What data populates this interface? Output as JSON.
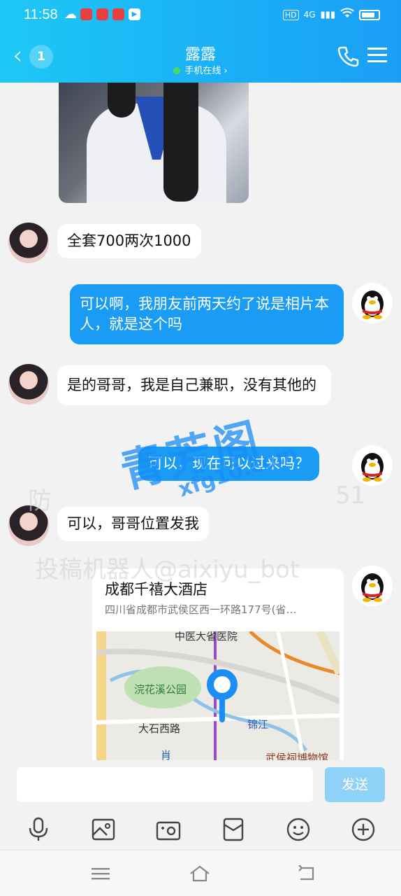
{
  "status_bar": {
    "time": "11:58",
    "network": "4G",
    "hd": "HD"
  },
  "header": {
    "back_count": "1",
    "contact_name": "露露",
    "status": "手机在线 ›"
  },
  "messages": [
    {
      "from": "contact",
      "text": "全套700两次1000"
    },
    {
      "from": "me",
      "text": "可以啊，我朋友前两天约了说是相片本人，就是这个吗"
    },
    {
      "from": "contact",
      "text": "是的哥哥，我是自己兼职，没有其他的"
    },
    {
      "from": "me",
      "text": "可以，现在可以过来吗？"
    },
    {
      "from": "contact",
      "text": "可以，哥哥位置发我"
    }
  ],
  "location": {
    "title": "成都千禧大酒店",
    "address": "四川省成都市武侯区西一环路177号(省…",
    "map_labels": {
      "hospital": "中医大省医院",
      "park": "浣花溪公园",
      "road": "大石西路",
      "river": "锦江",
      "museum": "武侯祠博物馆",
      "partial": "肖"
    }
  },
  "watermark": {
    "main": "青芳阁",
    "url": "xfg10.com",
    "gray1": "防",
    "gray2": "投稿机器人@aixiyu_bot",
    "gray3": "51"
  },
  "composer": {
    "input_value": "",
    "send_label": "发送"
  },
  "toolbar_icons": [
    "microphone-icon",
    "image-icon",
    "camera-icon",
    "red-packet-icon",
    "emoji-icon",
    "plus-icon"
  ],
  "colors": {
    "header_gradient_start": "#1ec8f5",
    "header_gradient_end": "#1b9ff6",
    "out_bubble": "#1a9cf5",
    "send_disabled": "#8fd2f8"
  }
}
